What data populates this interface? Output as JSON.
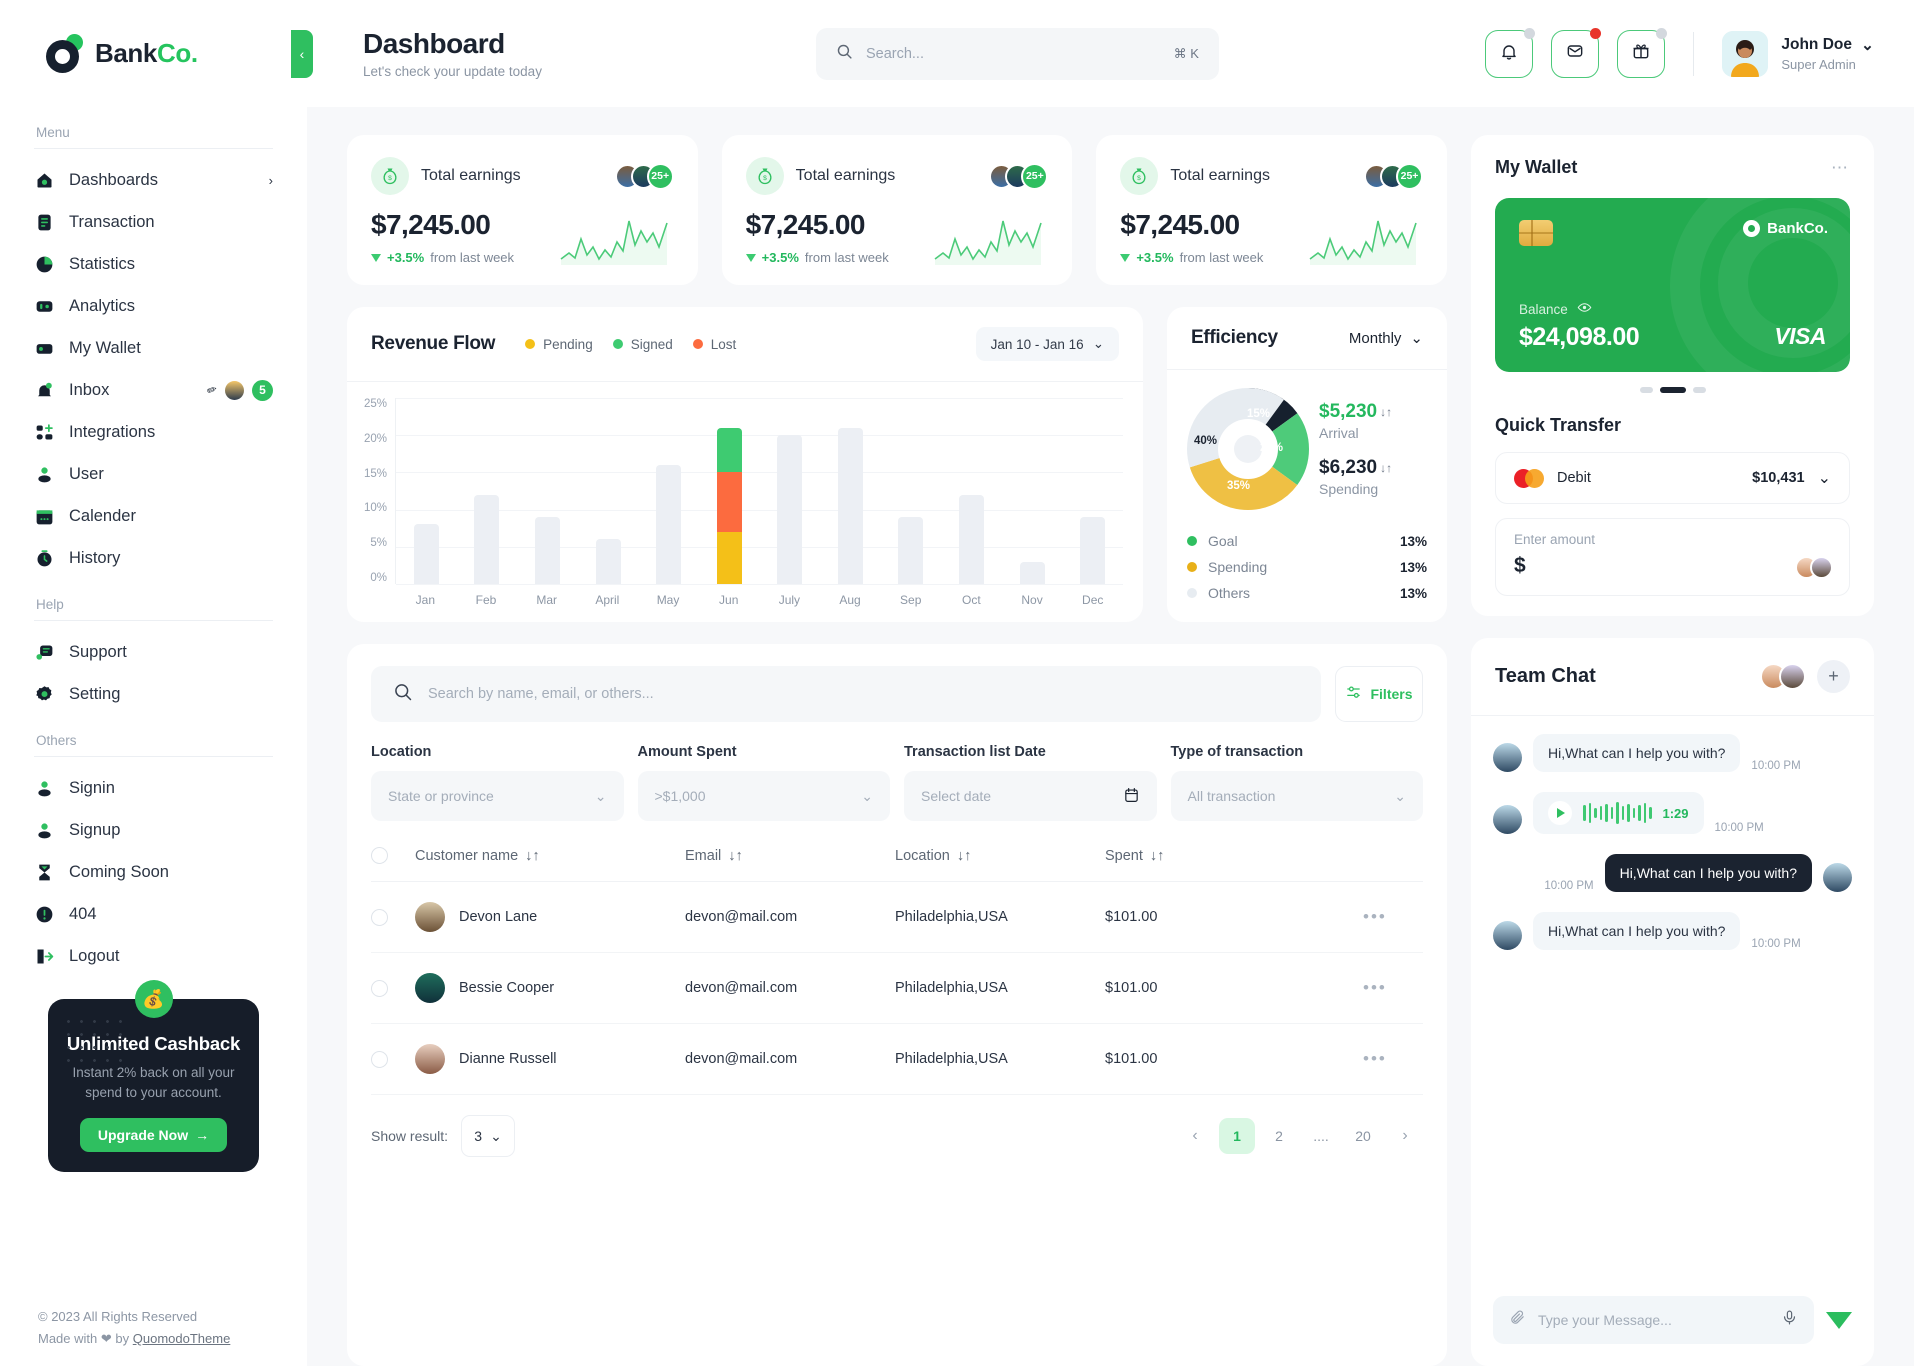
{
  "brand": {
    "name_dark": "Bank",
    "name_accent": "Co.",
    "collapse_icon": "chevron-left-icon"
  },
  "sidebar": {
    "sections": [
      {
        "label": "Menu",
        "items": [
          {
            "label": "Dashboards",
            "icon": "home-icon",
            "chevron": "›"
          },
          {
            "label": "Transaction",
            "icon": "clipboard-icon"
          },
          {
            "label": "Statistics",
            "icon": "pie-chart-icon"
          },
          {
            "label": "Analytics",
            "icon": "analytics-icon"
          },
          {
            "label": "My Wallet",
            "icon": "wallet-icon"
          },
          {
            "label": "Inbox",
            "icon": "bell-icon",
            "badge": "5"
          },
          {
            "label": "Integrations",
            "icon": "grid-plus-icon"
          },
          {
            "label": "User",
            "icon": "user-icon"
          },
          {
            "label": "Calender",
            "icon": "calendar-icon"
          },
          {
            "label": "History",
            "icon": "clock-icon"
          }
        ]
      },
      {
        "label": "Help",
        "items": [
          {
            "label": "Support",
            "icon": "support-icon"
          },
          {
            "label": "Setting",
            "icon": "gear-icon"
          }
        ]
      },
      {
        "label": "Others",
        "items": [
          {
            "label": "Signin",
            "icon": "user-icon"
          },
          {
            "label": "Signup",
            "icon": "user-icon"
          },
          {
            "label": "Coming Soon",
            "icon": "hourglass-icon"
          },
          {
            "label": "404",
            "icon": "alert-icon"
          },
          {
            "label": "Logout",
            "icon": "logout-icon"
          }
        ]
      }
    ],
    "promo": {
      "badge_icon": "money-bag-icon",
      "title": "Unlimited Cashback",
      "text": "Instant 2% back on all your spend to your account.",
      "button": "Upgrade Now",
      "button_arrow": "→"
    },
    "footer": {
      "copyright": "© 2023 All Rights Reserved",
      "made_prefix": "Made with",
      "heart": "❤",
      "made_mid": "by",
      "author": "QuomodoTheme"
    }
  },
  "header": {
    "title": "Dashboard",
    "subtitle": "Let's check your update today",
    "search": {
      "placeholder": "Search...",
      "shortcut": "⌘ K",
      "icon": "search-icon"
    },
    "actions": [
      {
        "name": "bell-icon",
        "dot": "#d3d8de"
      },
      {
        "name": "mail-icon",
        "dot": "#e8352b"
      },
      {
        "name": "gift-icon",
        "dot": "#d3d8de"
      }
    ],
    "profile": {
      "name": "John Doe",
      "role": "Super Admin",
      "chevron": "⌄"
    }
  },
  "stats": [
    {
      "title": "Total earnings",
      "value": "$7,245.00",
      "delta": "+3.5%",
      "delta_suffix": "from last week",
      "avatars_more": "25+",
      "icon": "money-bag-icon"
    },
    {
      "title": "Total earnings",
      "value": "$7,245.00",
      "delta": "+3.5%",
      "delta_suffix": "from last week",
      "avatars_more": "25+",
      "icon": "money-bag-icon"
    },
    {
      "title": "Total earnings",
      "value": "$7,245.00",
      "delta": "+3.5%",
      "delta_suffix": "from last week",
      "avatars_more": "25+",
      "icon": "money-bag-icon"
    }
  ],
  "revenue": {
    "title": "Revenue Flow",
    "legend": [
      {
        "label": "Pending",
        "color": "#f4c018"
      },
      {
        "label": "Signed",
        "color": "#3ecb71"
      },
      {
        "label": "Lost",
        "color": "#fc6b3f"
      }
    ],
    "range": "Jan 10 - Jan 16",
    "range_chevron": "⌄"
  },
  "efficiency": {
    "title": "Efficiency",
    "period": "Monthly",
    "period_chevron": "⌄",
    "arrival": {
      "amount": "$5,230",
      "label": "Arrival",
      "arrows": "↓↑"
    },
    "spending": {
      "amount": "$6,230",
      "label": "Spending",
      "arrows": "↓↑"
    },
    "legend": [
      {
        "label": "Goal",
        "value": "13%",
        "color": "#2fbf60"
      },
      {
        "label": "Spending",
        "value": "13%",
        "color": "#e8b018"
      },
      {
        "label": "Others",
        "value": "13%",
        "color": "#e7ecf1"
      }
    ]
  },
  "chart_data": [
    {
      "type": "bar",
      "title": "Revenue Flow",
      "xlabel": "",
      "ylabel": "",
      "ylim": [
        0,
        25
      ],
      "grid": true,
      "legend_position": "top",
      "categories": [
        "Jan",
        "Feb",
        "Mar",
        "April",
        "May",
        "Jun",
        "July",
        "Aug",
        "Sep",
        "Oct",
        "Nov",
        "Dec"
      ],
      "ytick_labels": [
        "0%",
        "5%",
        "10%",
        "15%",
        "20%",
        "25%"
      ],
      "values": [
        8,
        12,
        9,
        6,
        16,
        21,
        20,
        21,
        9,
        12,
        3,
        9
      ],
      "highlight_category": "Jun",
      "stacked_highlight": {
        "segments": [
          {
            "name": "Pending",
            "value": 7,
            "color": "#f4c018"
          },
          {
            "name": "Lost",
            "value": 8,
            "color": "#fc6b3f"
          },
          {
            "name": "Signed",
            "value": 6,
            "color": "#3ecb71"
          }
        ]
      },
      "inactive_bar_color": "#eceff4"
    },
    {
      "type": "pie",
      "title": "Efficiency",
      "labels": [
        "Others",
        "Goal",
        "Spending",
        "Arrival"
      ],
      "values": [
        40,
        20,
        35,
        15
      ],
      "slice_labels": [
        "40%",
        "20%",
        "35%",
        "15%"
      ],
      "colors": [
        "#e7ecf1",
        "#4ecb7a",
        "#efc044",
        "#16202e"
      ],
      "legend_position": "bottom"
    }
  ],
  "wallet": {
    "title": "My Wallet",
    "menu_icon": "more-horizontal-icon",
    "card": {
      "brand": "BankCo.",
      "balance_label": "Balance",
      "eye_icon": "eye-icon",
      "balance": "$24,098.00",
      "network": "VISA"
    },
    "carousel_index": 1,
    "quick_transfer": {
      "title": "Quick Transfer",
      "method": "Debit",
      "method_icon": "mastercard-icon",
      "method_amount": "$10,431",
      "chevron": "⌄",
      "amount_placeholder": "Enter amount",
      "amount_value": "$"
    }
  },
  "chat": {
    "title": "Team Chat",
    "add_icon": "plus-icon",
    "messages": [
      {
        "direction": "in",
        "type": "text",
        "text": "Hi,What can I help you with?",
        "time": "10:00 PM"
      },
      {
        "direction": "in",
        "type": "voice",
        "duration": "1:29",
        "time": "10:00 PM",
        "play_icon": "play-icon"
      },
      {
        "direction": "out",
        "type": "text",
        "text": "Hi,What can I help you with?",
        "time": "10:00 PM"
      },
      {
        "direction": "in",
        "type": "text",
        "text": "Hi,What can I help you with?",
        "time": "10:00 PM"
      }
    ],
    "input": {
      "placeholder": "Type your Message...",
      "attach_icon": "paperclip-icon",
      "mic_icon": "microphone-icon",
      "send_icon": "send-icon"
    }
  },
  "table": {
    "search_placeholder": "Search by name, email, or others...",
    "search_icon": "search-icon",
    "filters_label": "Filters",
    "filters_icon": "sliders-icon",
    "filters": [
      {
        "label": "Location",
        "value": "State or province",
        "icon": "chevron-down-icon"
      },
      {
        "label": "Amount Spent",
        "value": ">$1,000",
        "icon": "chevron-down-icon"
      },
      {
        "label": "Transaction list Date",
        "value": "Select date",
        "icon": "calendar-icon"
      },
      {
        "label": "Type of transaction",
        "value": "All transaction",
        "icon": "chevron-down-icon"
      }
    ],
    "columns": [
      "Customer name",
      "Email",
      "Location",
      "Spent"
    ],
    "sort_icon": "↓↑",
    "rows": [
      {
        "name": "Devon Lane",
        "email": "devon@mail.com",
        "location": "Philadelphia,USA",
        "spent": "$101.00"
      },
      {
        "name": "Bessie Cooper",
        "email": "devon@mail.com",
        "location": "Philadelphia,USA",
        "spent": "$101.00"
      },
      {
        "name": "Dianne Russell",
        "email": "devon@mail.com",
        "location": "Philadelphia,USA",
        "spent": "$101.00"
      }
    ],
    "row_menu_icon": "•••",
    "pagination": {
      "show_label": "Show result:",
      "show_value": "3",
      "prev": "‹",
      "next": "›",
      "pages": [
        "1",
        "2",
        "....",
        "20"
      ],
      "active": "1"
    }
  }
}
